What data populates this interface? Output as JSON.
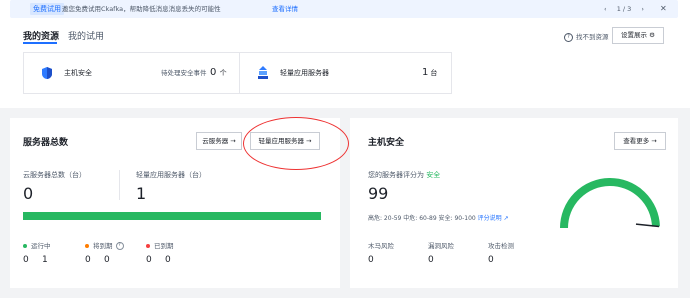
{
  "notice": {
    "tag": "免费试用",
    "text": "邀您免费试用Ckafka，帮助降低消息消息丢失的可能性",
    "link": "查看详情",
    "pager": {
      "prev": "‹",
      "page": "1 / 3",
      "next": "›"
    },
    "close": "✕"
  },
  "resources": {
    "tabs": {
      "active": "我的资源",
      "other": "我的试用"
    },
    "help": "找不到资源",
    "display_setting": "设置展示",
    "cards": [
      {
        "name": "主机安全",
        "meta": "待处理安全事件",
        "value": "0",
        "unit": "个"
      },
      {
        "name": "轻量应用服务器",
        "value": "1",
        "unit": "台"
      }
    ]
  },
  "servers": {
    "title": "服务器总数",
    "cvm_button": "云服务器 →",
    "lighthouse_button": "轻量应用服务器 →",
    "total_label": "云服务器总数（台）",
    "total_value": "0",
    "lighthouse_label": "轻量应用服务器（台）",
    "lighthouse_value": "1",
    "running_fraction": 1.0,
    "legend": [
      {
        "label": "运行中",
        "color": "#27b861",
        "values": [
          "0",
          "1"
        ]
      },
      {
        "label": "将到期",
        "color": "#ff7d00",
        "values": [
          "0",
          "0"
        ]
      },
      {
        "label": "已到期",
        "color": "#f53f3f",
        "values": [
          "0",
          "0"
        ]
      }
    ]
  },
  "host_security": {
    "title": "主机安全",
    "more_button": "查看更多 →",
    "score_label": "您的服务器评分为",
    "score_status": "安全",
    "score_value": "99",
    "score_rule": "高危: 20-59  中危: 60-89  安全: 90-100",
    "score_rule_link": "评分说明 ↗",
    "gauge_fraction": 0.99,
    "risks": [
      {
        "label": "木马风险",
        "value": "0"
      },
      {
        "label": "漏洞风险",
        "value": "0"
      },
      {
        "label": "攻击检测",
        "value": "0"
      }
    ],
    "colors": {
      "safe": "#27b861",
      "accent": "#1e6fff"
    }
  }
}
